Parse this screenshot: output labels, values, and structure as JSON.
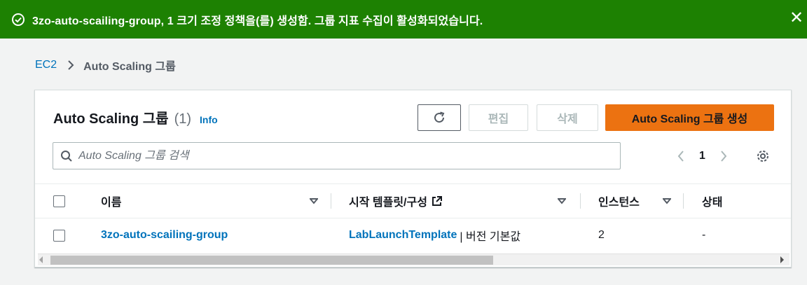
{
  "flash": {
    "message": "3zo-auto-scailing-group, 1 크기 조정 정책을(를) 생성함. 그룹 지표 수집이 활성화되었습니다.",
    "icon": "check-circle-icon",
    "close": "✕",
    "color": "#1d8102"
  },
  "breadcrumb": {
    "root": "EC2",
    "current": "Auto Scaling 그룹"
  },
  "panel": {
    "title": "Auto Scaling 그룹",
    "count": "(1)",
    "info": "Info",
    "buttons": {
      "edit": "편집",
      "delete": "삭제",
      "create": "Auto Scaling 그룹 생성"
    },
    "search": {
      "placeholder": "Auto Scaling 그룹 검색"
    },
    "pagination": {
      "page": "1"
    },
    "accent": "#ec7211"
  },
  "table": {
    "columns": [
      "이름",
      "시작 템플릿/구성",
      "인스턴스",
      "상태"
    ],
    "rows": [
      {
        "name": "3zo-auto-scailing-group",
        "template": "LabLaunchTemplate",
        "template_suffix": "| 버전 기본값",
        "instances": "2",
        "status": "-"
      }
    ]
  }
}
